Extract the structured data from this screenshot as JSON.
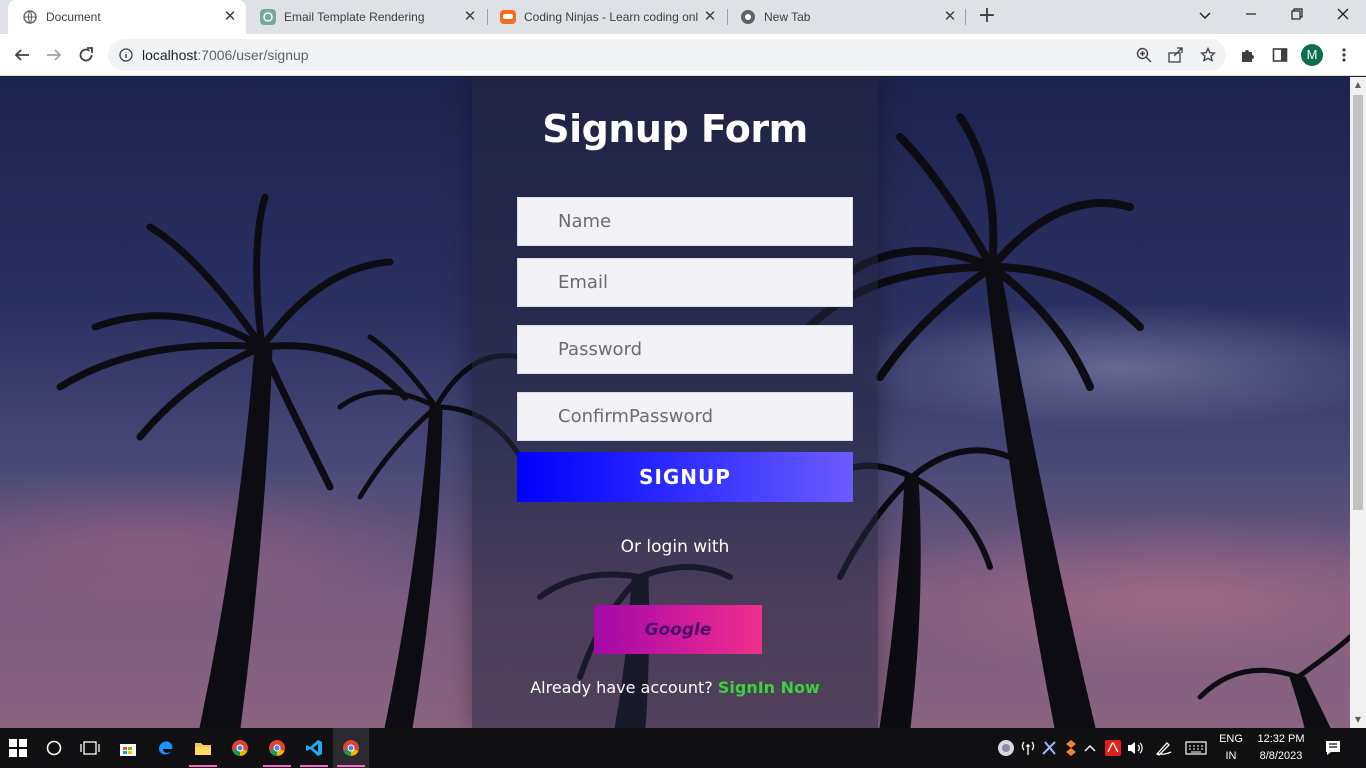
{
  "browser": {
    "tabs": [
      {
        "title": "Document",
        "active": true
      },
      {
        "title": "Email Template Rendering",
        "active": false
      },
      {
        "title": "Coding Ninjas - Learn coding onl",
        "active": false
      },
      {
        "title": "New Tab",
        "active": false
      }
    ],
    "url_host": "localhost",
    "url_rest": ":7006/user/signup",
    "profile_initial": "M"
  },
  "form": {
    "title": "Signup Form",
    "name_placeholder": "Name",
    "email_placeholder": "Email",
    "password_placeholder": "Password",
    "confirm_placeholder": "ConfirmPassword",
    "signup_label": "SIGNUP",
    "or_text": "Or login with",
    "google_label": "Google",
    "already_text": "Already have account?",
    "signin_label": "SignIn Now"
  },
  "taskbar": {
    "lang_top": "ENG",
    "lang_bottom": "IN",
    "time": "12:32 PM",
    "date": "8/8/2023"
  },
  "colors": {
    "signup_gradient": [
      "#0000ff",
      "#6b5cff"
    ],
    "google_gradient": [
      "#a20aa8",
      "#f0308a"
    ],
    "signin_link": "#3dd13d"
  }
}
